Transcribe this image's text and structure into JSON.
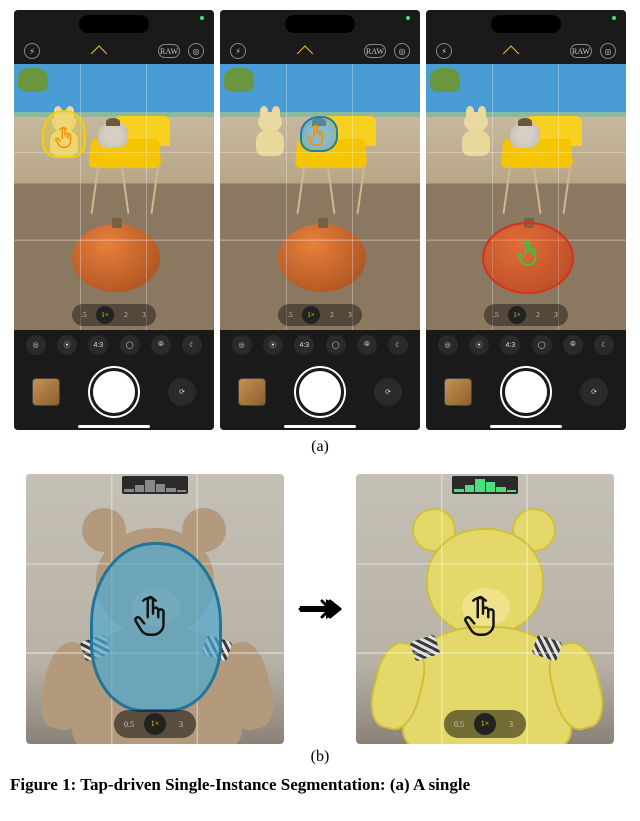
{
  "sublabel_a": "(a)",
  "sublabel_b": "(b)",
  "caption_line": "Figure 1: Tap-driven Single-Instance Segmentation: (a) A single",
  "topbar": {
    "flash_glyph": "⚡︎",
    "raw_label": "RAW",
    "hdr_glyph": "◎"
  },
  "option_row": {
    "opt1": "◎",
    "opt2": "⦿",
    "opt3": "4:3",
    "opt4": "◯",
    "opt5": "⦾",
    "opt6": "☾"
  },
  "zoom": {
    "z1": ".5",
    "z2": "1×",
    "z3": "2",
    "z4": "3"
  },
  "zoom_b": {
    "z1": "0.5",
    "z2": "1×",
    "z3": "3"
  },
  "switch_cam_glyph": "⟳"
}
